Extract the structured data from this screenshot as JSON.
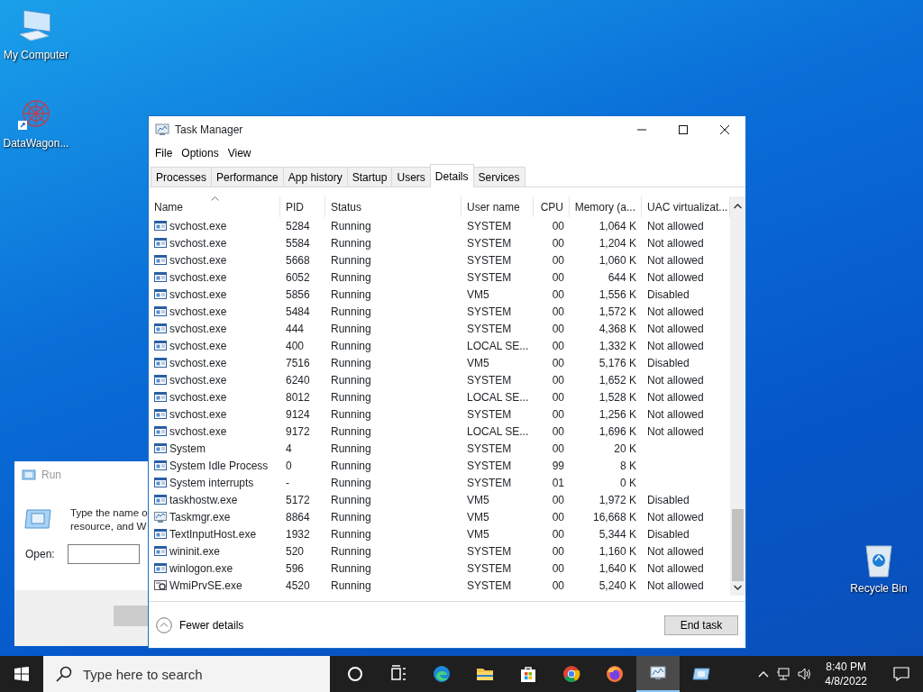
{
  "desktop_icons": [
    {
      "label": "My Computer",
      "kind": "computer"
    },
    {
      "label": "DataWagon...",
      "kind": "shortcut"
    },
    {
      "label": "Recycle Bin",
      "kind": "recycle"
    }
  ],
  "run_dialog": {
    "title": "Run",
    "text_lines": [
      "Type the name o",
      "resource, and W"
    ],
    "open_label": "Open:"
  },
  "task_manager": {
    "title": "Task Manager",
    "menu": [
      "File",
      "Options",
      "View"
    ],
    "tabs": [
      {
        "label": "Processes",
        "selected": false
      },
      {
        "label": "Performance",
        "selected": false
      },
      {
        "label": "App history",
        "selected": false
      },
      {
        "label": "Startup",
        "selected": false
      },
      {
        "label": "Users",
        "selected": false
      },
      {
        "label": "Details",
        "selected": true
      },
      {
        "label": "Services",
        "selected": false
      }
    ],
    "columns": [
      {
        "label": "Name",
        "sorted": true
      },
      {
        "label": "PID",
        "sorted": false
      },
      {
        "label": "Status",
        "sorted": false
      },
      {
        "label": "User name",
        "sorted": false
      },
      {
        "label": "CPU",
        "sorted": false
      },
      {
        "label": "Memory (a...",
        "sorted": false
      },
      {
        "label": "UAC virtualizat...",
        "sorted": false
      }
    ],
    "rows": [
      {
        "kind": "window",
        "name": "svchost.exe",
        "pid": "5284",
        "status": "Running",
        "user": "SYSTEM",
        "cpu": "00",
        "memory": "1,064 K",
        "uac": "Not allowed"
      },
      {
        "kind": "window",
        "name": "svchost.exe",
        "pid": "5584",
        "status": "Running",
        "user": "SYSTEM",
        "cpu": "00",
        "memory": "1,204 K",
        "uac": "Not allowed"
      },
      {
        "kind": "window",
        "name": "svchost.exe",
        "pid": "5668",
        "status": "Running",
        "user": "SYSTEM",
        "cpu": "00",
        "memory": "1,060 K",
        "uac": "Not allowed"
      },
      {
        "kind": "window",
        "name": "svchost.exe",
        "pid": "6052",
        "status": "Running",
        "user": "SYSTEM",
        "cpu": "00",
        "memory": "644 K",
        "uac": "Not allowed"
      },
      {
        "kind": "window",
        "name": "svchost.exe",
        "pid": "5856",
        "status": "Running",
        "user": "VM5",
        "cpu": "00",
        "memory": "1,556 K",
        "uac": "Disabled"
      },
      {
        "kind": "window",
        "name": "svchost.exe",
        "pid": "5484",
        "status": "Running",
        "user": "SYSTEM",
        "cpu": "00",
        "memory": "1,572 K",
        "uac": "Not allowed"
      },
      {
        "kind": "window",
        "name": "svchost.exe",
        "pid": "444",
        "status": "Running",
        "user": "SYSTEM",
        "cpu": "00",
        "memory": "4,368 K",
        "uac": "Not allowed"
      },
      {
        "kind": "window",
        "name": "svchost.exe",
        "pid": "400",
        "status": "Running",
        "user": "LOCAL SE...",
        "cpu": "00",
        "memory": "1,332 K",
        "uac": "Not allowed"
      },
      {
        "kind": "window",
        "name": "svchost.exe",
        "pid": "7516",
        "status": "Running",
        "user": "VM5",
        "cpu": "00",
        "memory": "5,176 K",
        "uac": "Disabled"
      },
      {
        "kind": "window",
        "name": "svchost.exe",
        "pid": "6240",
        "status": "Running",
        "user": "SYSTEM",
        "cpu": "00",
        "memory": "1,652 K",
        "uac": "Not allowed"
      },
      {
        "kind": "window",
        "name": "svchost.exe",
        "pid": "8012",
        "status": "Running",
        "user": "LOCAL SE...",
        "cpu": "00",
        "memory": "1,528 K",
        "uac": "Not allowed"
      },
      {
        "kind": "window",
        "name": "svchost.exe",
        "pid": "9124",
        "status": "Running",
        "user": "SYSTEM",
        "cpu": "00",
        "memory": "1,256 K",
        "uac": "Not allowed"
      },
      {
        "kind": "window",
        "name": "svchost.exe",
        "pid": "9172",
        "status": "Running",
        "user": "LOCAL SE...",
        "cpu": "00",
        "memory": "1,696 K",
        "uac": "Not allowed"
      },
      {
        "kind": "window",
        "name": "System",
        "pid": "4",
        "status": "Running",
        "user": "SYSTEM",
        "cpu": "00",
        "memory": "20 K"
      },
      {
        "kind": "window",
        "name": "System Idle Process",
        "pid": "0",
        "status": "Running",
        "user": "SYSTEM",
        "cpu": "99",
        "memory": "8 K"
      },
      {
        "kind": "window",
        "name": "System interrupts",
        "pid": "-",
        "status": "Running",
        "user": "SYSTEM",
        "cpu": "01",
        "memory": "0 K"
      },
      {
        "kind": "window",
        "name": "taskhostw.exe",
        "pid": "5172",
        "status": "Running",
        "user": "VM5",
        "cpu": "00",
        "memory": "1,972 K",
        "uac": "Disabled"
      },
      {
        "kind": "monitor",
        "name": "Taskmgr.exe",
        "pid": "8864",
        "status": "Running",
        "user": "VM5",
        "cpu": "00",
        "memory": "16,668 K",
        "uac": "Not allowed"
      },
      {
        "kind": "window",
        "name": "TextInputHost.exe",
        "pid": "1932",
        "status": "Running",
        "user": "VM5",
        "cpu": "00",
        "memory": "5,344 K",
        "uac": "Disabled"
      },
      {
        "kind": "window",
        "name": "wininit.exe",
        "pid": "520",
        "status": "Running",
        "user": "SYSTEM",
        "cpu": "00",
        "memory": "1,160 K",
        "uac": "Not allowed"
      },
      {
        "kind": "window",
        "name": "winlogon.exe",
        "pid": "596",
        "status": "Running",
        "user": "SYSTEM",
        "cpu": "00",
        "memory": "1,640 K",
        "uac": "Not allowed"
      },
      {
        "kind": "gear",
        "name": "WmiPrvSE.exe",
        "pid": "4520",
        "status": "Running",
        "user": "SYSTEM",
        "cpu": "00",
        "memory": "5,240 K",
        "uac": "Not allowed"
      }
    ],
    "fewer_details": "Fewer details",
    "end_task": "End task"
  },
  "taskbar": {
    "search_placeholder": "Type here to search",
    "apps": [
      {
        "kind": "cortana",
        "active": false
      },
      {
        "kind": "taskview",
        "active": false
      },
      {
        "kind": "edge",
        "active": false
      },
      {
        "kind": "folder",
        "active": false
      },
      {
        "kind": "store",
        "active": false
      },
      {
        "kind": "chrome",
        "active": false
      },
      {
        "kind": "firefox",
        "active": false
      },
      {
        "kind": "taskmgr",
        "active": true
      },
      {
        "kind": "run",
        "active": false
      }
    ],
    "time": "8:40 PM",
    "date": "4/8/2022"
  }
}
